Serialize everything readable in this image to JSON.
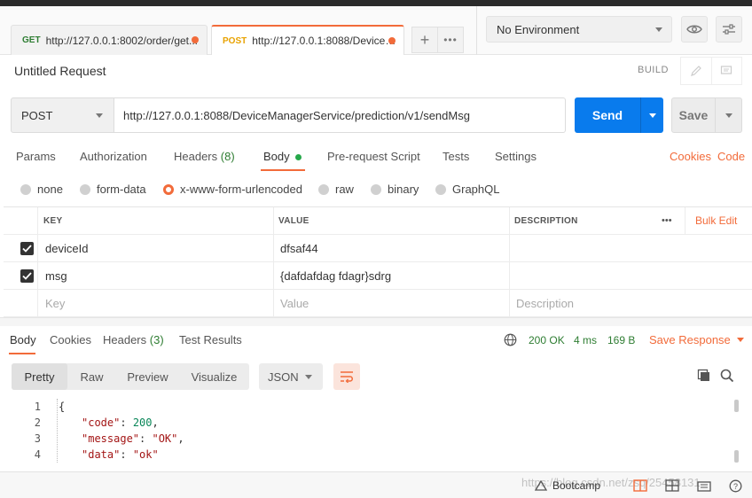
{
  "tabs": [
    {
      "method": "GET",
      "url": "http://127.0.0.1:8002/order/get..."
    },
    {
      "method": "POST",
      "url": "http://127.0.0.1:8088/DeviceM..."
    }
  ],
  "tab_actions": {
    "new": "+",
    "more": "•••"
  },
  "environment": {
    "selected": "No Environment"
  },
  "request": {
    "title": "Untitled Request",
    "build_label": "BUILD",
    "method": "POST",
    "url": "http://127.0.0.1:8088/DeviceManagerService/prediction/v1/sendMsg",
    "send_label": "Send",
    "save_label": "Save"
  },
  "request_tabs": {
    "params": "Params",
    "authorization": "Authorization",
    "headers": "Headers",
    "headers_count": "(8)",
    "body": "Body",
    "pre_request": "Pre-request Script",
    "tests": "Tests",
    "settings": "Settings",
    "cookies": "Cookies",
    "code": "Code"
  },
  "body_types": [
    "none",
    "form-data",
    "x-www-form-urlencoded",
    "raw",
    "binary",
    "GraphQL"
  ],
  "body_type_selected": "x-www-form-urlencoded",
  "params_table": {
    "headers": {
      "key": "KEY",
      "value": "VALUE",
      "description": "DESCRIPTION",
      "bulk_edit": "Bulk Edit",
      "more": "•••"
    },
    "rows": [
      {
        "key": "deviceId",
        "value": "dfsaf44",
        "checked": true
      },
      {
        "key": "msg",
        "value": "{dafdafdag fdagr}sdrg",
        "checked": true
      }
    ],
    "placeholder": {
      "key": "Key",
      "value": "Value",
      "description": "Description"
    }
  },
  "response_tabs": {
    "body": "Body",
    "cookies": "Cookies",
    "headers": "Headers",
    "headers_count": "(3)",
    "test_results": "Test Results"
  },
  "response_status": {
    "status": "200 OK",
    "time": "4 ms",
    "size": "169 B",
    "save_label": "Save Response"
  },
  "view_modes": [
    "Pretty",
    "Raw",
    "Preview",
    "Visualize"
  ],
  "view_mode_selected": "Pretty",
  "format": "JSON",
  "response_body": [
    {
      "line": "1",
      "text": "{"
    },
    {
      "line": "2",
      "key": "\"code\"",
      "value": "200",
      "type": "number",
      "trailing": ","
    },
    {
      "line": "3",
      "key": "\"message\"",
      "value": "\"OK\"",
      "type": "string",
      "trailing": ","
    },
    {
      "line": "4",
      "key": "\"data\"",
      "value": "\"ok\"",
      "type": "string",
      "trailing": ""
    }
  ],
  "statusbar": {
    "bootcamp": "Bootcamp",
    "watermark": "https://blog.csdn.net/zsq/25458131"
  },
  "colors": {
    "accent": "#f26b3a",
    "send": "#097bed",
    "success": "#2e7d32"
  }
}
